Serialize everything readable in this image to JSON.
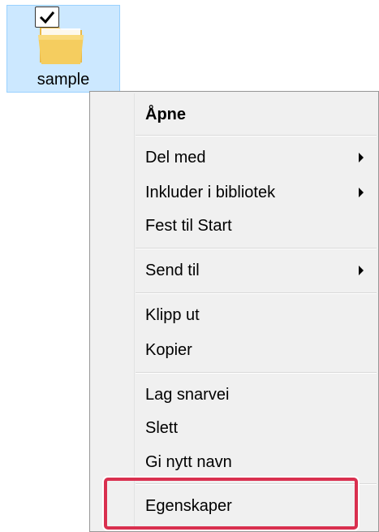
{
  "desktop": {
    "folder": {
      "name": "sample",
      "checked": true,
      "icon": "folder-icon"
    }
  },
  "context_menu": {
    "items": [
      {
        "label": "Åpne",
        "bold": true,
        "submenu": false
      },
      {
        "label": "Del med",
        "bold": false,
        "submenu": true
      },
      {
        "label": "Inkluder i bibliotek",
        "bold": false,
        "submenu": true
      },
      {
        "label": "Fest til Start",
        "bold": false,
        "submenu": false
      },
      {
        "label": "Send til",
        "bold": false,
        "submenu": true
      },
      {
        "label": "Klipp ut",
        "bold": false,
        "submenu": false
      },
      {
        "label": "Kopier",
        "bold": false,
        "submenu": false
      },
      {
        "label": "Lag snarvei",
        "bold": false,
        "submenu": false
      },
      {
        "label": "Slett",
        "bold": false,
        "submenu": false
      },
      {
        "label": "Gi nytt navn",
        "bold": false,
        "submenu": false
      },
      {
        "label": "Egenskaper",
        "bold": false,
        "submenu": false,
        "highlighted": true
      }
    ]
  },
  "colors": {
    "selection": "#cce8ff",
    "menu_background": "#f0f0f0",
    "highlight_frame": "#d9304f"
  }
}
